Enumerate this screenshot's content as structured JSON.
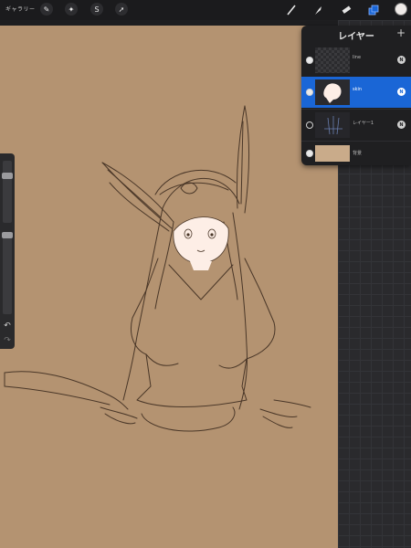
{
  "topbar": {
    "gallery_label": "ギャラリー",
    "left_tools": [
      {
        "name": "wrench-icon",
        "glyph": "✎"
      },
      {
        "name": "magic-wand-icon",
        "glyph": "✦"
      },
      {
        "name": "selection-icon",
        "glyph": "S"
      },
      {
        "name": "move-arrow-icon",
        "glyph": "➚"
      }
    ],
    "right_tools": [
      {
        "name": "brush-icon",
        "glyph": "／"
      },
      {
        "name": "smudge-icon",
        "glyph": "✋"
      },
      {
        "name": "eraser-icon",
        "glyph": "▰"
      },
      {
        "name": "layers-icon",
        "glyph": "❐"
      }
    ],
    "active_color": "#f0ebe8"
  },
  "layers_panel": {
    "title": "レイヤー",
    "add_label": "+",
    "layers": [
      {
        "name": "line",
        "visible": true,
        "mode": "N",
        "active": false
      },
      {
        "name": "skin",
        "visible": true,
        "mode": "N",
        "active": true
      },
      {
        "name": "レイヤー1",
        "visible": false,
        "mode": "N",
        "active": false
      },
      {
        "name": "背景",
        "visible": true,
        "mode": "",
        "active": false
      }
    ]
  },
  "sidebar": {
    "brush_size_level": 0.78,
    "opacity_level": 0.05,
    "undo_label": "↶",
    "redo_label": "↷"
  },
  "colors": {
    "canvas": "#b49371",
    "accent": "#1a66d6",
    "line": "#4a3728",
    "skin": "#fdeee6"
  }
}
